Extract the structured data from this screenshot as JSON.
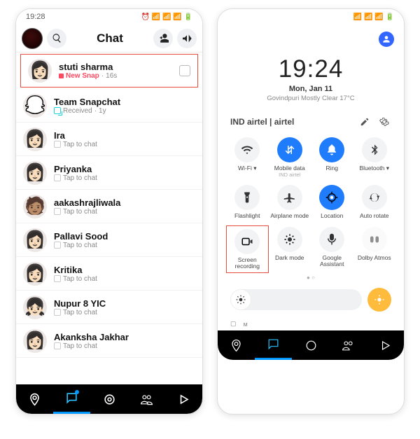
{
  "left": {
    "status": {
      "time": "19:28",
      "icons": "⏰ 📶 📶 📶 🔋"
    },
    "header": {
      "title": "Chat",
      "search_icon": "search",
      "add_friend_icon": "add-user",
      "announce_icon": "megaphone"
    },
    "chats": [
      {
        "name": "stuti sharma",
        "status_kind": "newsnap",
        "status_label": "New Snap",
        "time": "16s",
        "highlight": true,
        "tail_reply": true
      },
      {
        "name": "Team Snapchat",
        "status_kind": "received",
        "status_label": "Received",
        "time": "1y",
        "is_team": true
      },
      {
        "name": "Ira",
        "status_kind": "tap",
        "status_label": "Tap to chat"
      },
      {
        "name": "Priyanka",
        "status_kind": "tap",
        "status_label": "Tap to chat"
      },
      {
        "name": "aakashrajliwala",
        "status_kind": "tap",
        "status_label": "Tap to chat"
      },
      {
        "name": "Pallavi Sood",
        "status_kind": "tap",
        "status_label": "Tap to chat"
      },
      {
        "name": "Kritika",
        "status_kind": "tap",
        "status_label": "Tap to chat"
      },
      {
        "name": "Nupur 8 YIC",
        "status_kind": "tap",
        "status_label": "Tap to chat"
      },
      {
        "name": "Akanksha Jakhar",
        "status_kind": "tap",
        "status_label": "Tap to chat"
      }
    ],
    "nav": [
      "map",
      "chat",
      "camera",
      "friends",
      "play"
    ]
  },
  "right": {
    "status": {
      "icons": "📶 📶 📶 🔋"
    },
    "clock": "19:24",
    "date": "Mon, Jan 11",
    "weather": "Govindpuri Mostly Clear 17°C",
    "carrier": "IND airtel | airtel",
    "tiles": [
      {
        "id": "wifi",
        "label": "Wi-Fi ▾",
        "on": false
      },
      {
        "id": "mobile-data",
        "label": "Mobile data",
        "sub": "IND airtel",
        "on": true
      },
      {
        "id": "ring",
        "label": "Ring",
        "on": true
      },
      {
        "id": "bluetooth",
        "label": "Bluetooth ▾",
        "on": false
      },
      {
        "id": "flashlight",
        "label": "Flashlight",
        "on": false
      },
      {
        "id": "airplane",
        "label": "Airplane mode",
        "on": false
      },
      {
        "id": "location",
        "label": "Location",
        "on": true
      },
      {
        "id": "autorotate",
        "label": "Auto rotate",
        "on": false
      },
      {
        "id": "screenrecord",
        "label": "Screen recording",
        "on": false,
        "highlight": true
      },
      {
        "id": "darkmode",
        "label": "Dark mode",
        "on": false
      },
      {
        "id": "assistant",
        "label": "Google Assistant",
        "on": false
      },
      {
        "id": "dolby",
        "label": "Dolby Atmos",
        "on": false,
        "disabled": true
      }
    ],
    "dots": "● ○"
  }
}
